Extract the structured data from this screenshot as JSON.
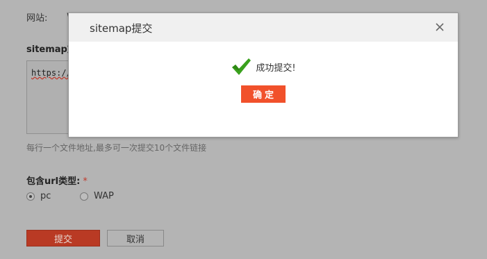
{
  "form": {
    "site_label": "网站:",
    "site_value": "w",
    "sitemap_label": "sitemap文",
    "textarea_value": "https://",
    "hint": "每行一个文件地址,最多可一次提交10个文件链接",
    "url_type_label": "包含url类型:",
    "required_mark": "*",
    "radio_options": [
      {
        "label": "pc",
        "selected": true
      },
      {
        "label": "WAP",
        "selected": false
      }
    ],
    "submit_label": "提交",
    "cancel_label": "取消"
  },
  "modal": {
    "title": "sitemap提交",
    "message": "成功提交!",
    "ok_label": "确定",
    "close_icon": "close-icon",
    "status_icon": "checkmark-icon"
  },
  "colors": {
    "overlay": "#b4b4b4",
    "accent": "#f1512b",
    "submit": "#b93a24",
    "success": "#3aa11d"
  }
}
